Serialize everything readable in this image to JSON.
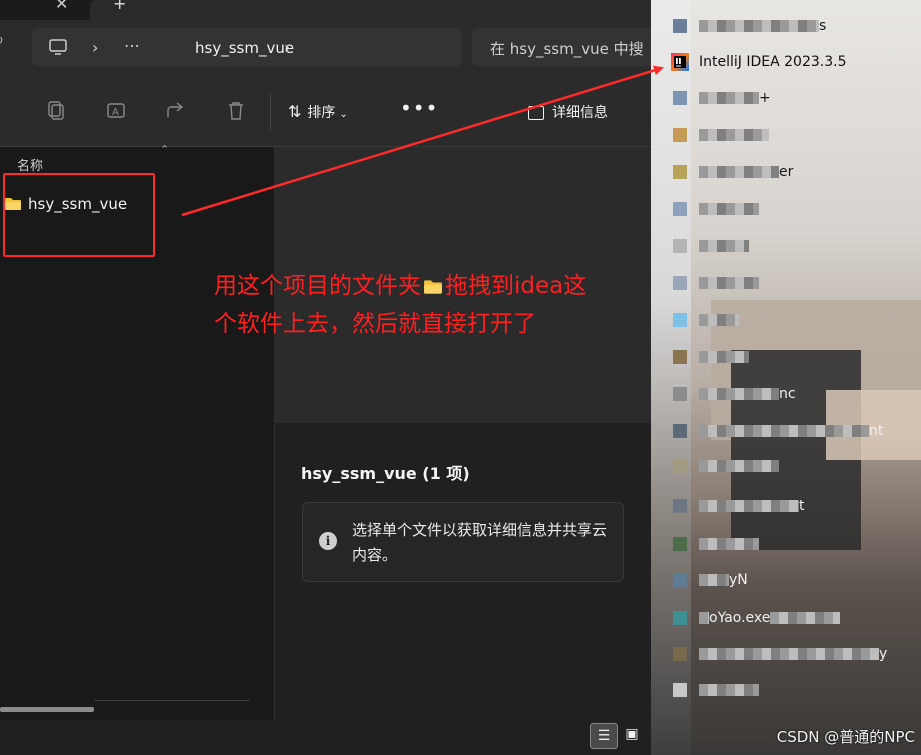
{
  "explorer": {
    "address": {
      "more_label": "⋯",
      "current_folder": "hsy_ssm_vue"
    },
    "search": {
      "placeholder": "在 hsy_ssm_vue 中搜"
    },
    "toolbar": {
      "sort_label": "排序",
      "more_label": "•••",
      "details_label": "详细信息"
    },
    "file_list": {
      "column_name": "名称",
      "items": [
        {
          "name": "hsy_ssm_vue",
          "type": "folder"
        }
      ]
    },
    "preview": {
      "title": "hsy_ssm_vue (1 项)",
      "info_text": "选择单个文件以获取详细信息并共享云内容。"
    }
  },
  "annotation": {
    "text_part1": "用这个项目的文件夹",
    "text_part2": "拖拽到idea这个软件上去，然后就直接打开了",
    "color": "#ff2020"
  },
  "start_menu": {
    "apps": [
      {
        "label": "s"
      },
      {
        "label": "IntelliJ IDEA 2023.3.5",
        "highlight": true
      },
      {
        "label": "+"
      },
      {
        "label": ""
      },
      {
        "label": "er"
      },
      {
        "label": ""
      },
      {
        "label": ""
      },
      {
        "label": ""
      },
      {
        "label": ""
      },
      {
        "label": ""
      },
      {
        "label": ""
      },
      {
        "label": "nc"
      },
      {
        "label": "nt"
      },
      {
        "label": ""
      },
      {
        "label": "t"
      },
      {
        "label": ""
      },
      {
        "label": "yN"
      },
      {
        "label": "oYao.exe"
      },
      {
        "label": "y"
      },
      {
        "label": ""
      }
    ]
  },
  "watermark": "CSDN @普通的NPC",
  "colors": {
    "annotation_red": "#ff2a2a",
    "explorer_bg": "#202020",
    "toolbar_bg": "#2b2b2b",
    "folder_yellow": "#f3c13a"
  }
}
